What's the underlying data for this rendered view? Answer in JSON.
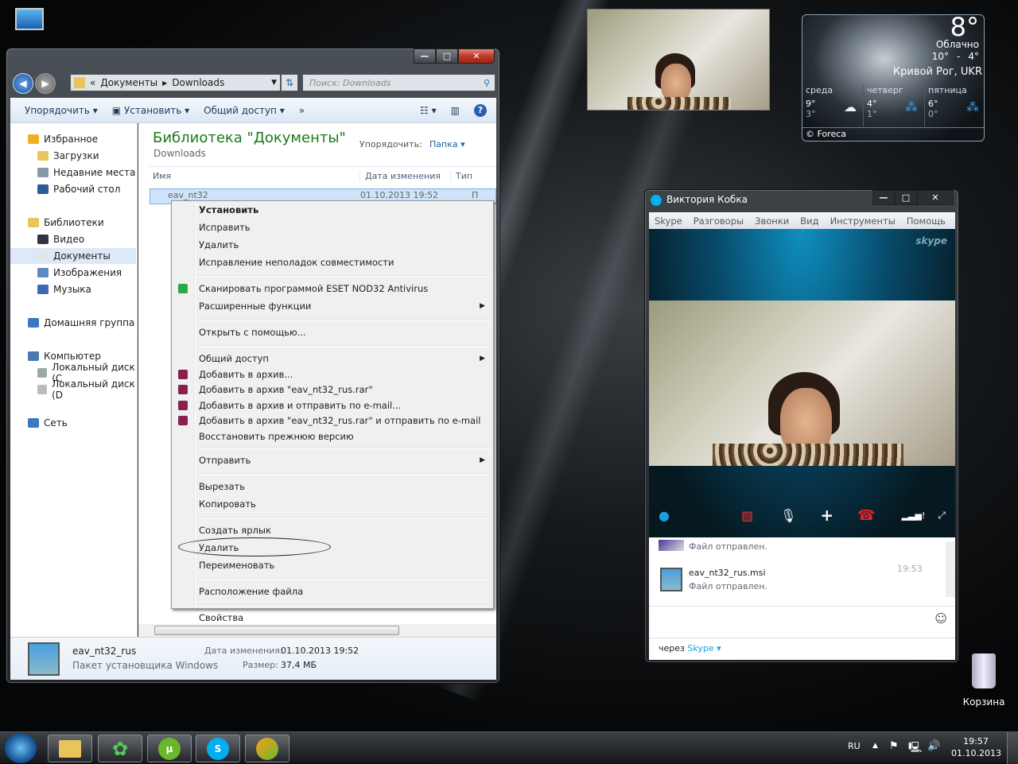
{
  "desktop": {
    "recycle_bin": "Корзина"
  },
  "explorer": {
    "address": {
      "chevrons": "«",
      "crumb1": "Документы",
      "crumb2": "Downloads"
    },
    "search_placeholder": "Поиск: Downloads",
    "toolbar": {
      "organize": "Упорядочить",
      "install": "Установить",
      "share": "Общий доступ",
      "more": "»"
    },
    "nav": [
      {
        "label": "Избранное",
        "group": true,
        "color": "#f0b020"
      },
      {
        "label": "Загрузки",
        "color": "#e8c45a"
      },
      {
        "label": "Недавние места",
        "color": "#8899aa"
      },
      {
        "label": "Рабочий стол",
        "color": "#2c5a9a"
      },
      {
        "label": "Библиотеки",
        "group": true,
        "color": "#e8c45a"
      },
      {
        "label": "Видео",
        "color": "#334"
      },
      {
        "label": "Документы",
        "color": "#dfe6ee",
        "selected": true
      },
      {
        "label": "Изображения",
        "color": "#5a8ac0"
      },
      {
        "label": "Музыка",
        "color": "#3a6ab0"
      },
      {
        "label": "Домашняя группа",
        "group": true,
        "color": "#3b78c4"
      },
      {
        "label": "Компьютер",
        "group": true,
        "color": "#4a7ab0"
      },
      {
        "label": "Локальный диск (C",
        "color": "#9aa"
      },
      {
        "label": "Локальный диск (D",
        "color": "#bbb"
      },
      {
        "label": "Сеть",
        "group": true,
        "color": "#3a7abf"
      }
    ],
    "library_title": "Библиотека \"Документы\"",
    "library_sub": "Downloads",
    "arrange_label": "Упорядочить:",
    "arrange_value": "Папка",
    "columns": {
      "name": "Имя",
      "date": "Дата изменения",
      "type": "Тип"
    },
    "file_row": {
      "name": "eav_nt32",
      "date": "01.10.2013 19:52",
      "type": "П"
    },
    "details": {
      "name": "eav_nt32_rus",
      "kind": "Пакет установщика Windows",
      "date_label": "Дата изменения:",
      "date": "01.10.2013 19:52",
      "size_label": "Размер:",
      "size": "37,4 МБ"
    }
  },
  "context_menu": [
    {
      "label": "Установить",
      "bold": true
    },
    {
      "label": "Исправить"
    },
    {
      "label": "Удалить"
    },
    {
      "label": "Исправление неполадок совместимости"
    },
    {
      "sep": true
    },
    {
      "label": "Сканировать программой ESET NOD32 Antivirus",
      "icon": "#2aa84a"
    },
    {
      "label": "Расширенные функции",
      "sub": true
    },
    {
      "sep": true
    },
    {
      "label": "Открыть с помощью..."
    },
    {
      "sep": true
    },
    {
      "label": "Общий доступ",
      "sub": true
    },
    {
      "label": "Добавить в архив...",
      "icon": "#8a2050"
    },
    {
      "label": "Добавить в архив \"eav_nt32_rus.rar\"",
      "icon": "#8a2050"
    },
    {
      "label": "Добавить в архив и отправить по e-mail...",
      "icon": "#8a2050"
    },
    {
      "label": "Добавить в архив \"eav_nt32_rus.rar\" и отправить по e-mail",
      "icon": "#8a2050"
    },
    {
      "label": "Восстановить прежнюю версию"
    },
    {
      "sep": true
    },
    {
      "label": "Отправить",
      "sub": true
    },
    {
      "sep": true
    },
    {
      "label": "Вырезать"
    },
    {
      "label": "Копировать"
    },
    {
      "sep": true
    },
    {
      "label": "Создать ярлык"
    },
    {
      "label": "Удалить",
      "circled": true
    },
    {
      "label": "Переименовать"
    },
    {
      "sep": true
    },
    {
      "label": "Расположение файла"
    },
    {
      "sep": true
    },
    {
      "label": "Свойства"
    }
  ],
  "skype": {
    "title": "Виктория Кобка",
    "menu": [
      "Skype",
      "Разговоры",
      "Звонки",
      "Вид",
      "Инструменты",
      "Помощь"
    ],
    "logo": "skype",
    "chat": [
      {
        "file": "",
        "status": "Файл отправлен."
      },
      {
        "file": "eav_nt32_rus.msi",
        "status": "Файл отправлен.",
        "time": "19:53"
      }
    ],
    "via_label": "через",
    "via_value": "Skype"
  },
  "weather": {
    "temp": "8°",
    "condition": "Облачно",
    "range_hi": "10°",
    "range_sep": "-",
    "range_lo": "4°",
    "city": "Кривой Рог, UKR",
    "days": [
      {
        "name": "среда",
        "hi": "9°",
        "lo": "3°"
      },
      {
        "name": "четверг",
        "hi": "4°",
        "lo": "1°"
      },
      {
        "name": "пятница",
        "hi": "6°",
        "lo": "0°"
      }
    ],
    "credit": "© Foreca"
  },
  "taskbar": {
    "lang": "RU",
    "time": "19:57",
    "date": "01.10.2013"
  },
  "colors": {
    "accent": "#1e5fa8",
    "green_title": "#1a7a1a",
    "skype_blue": "#00aff0"
  }
}
